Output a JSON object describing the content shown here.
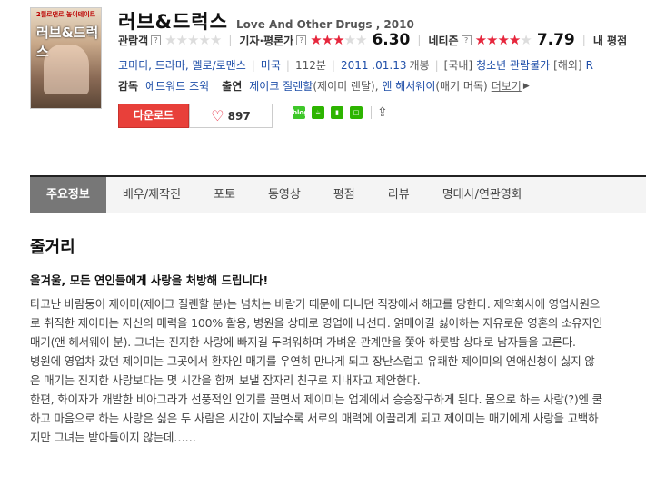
{
  "poster": {
    "top_text": "2월로맨로 놓이테이트",
    "title": "러브&드럭스"
  },
  "movie": {
    "title_ko": "러브&드럭스",
    "title_en": "Love And Other Drugs , 2010"
  },
  "ratings": [
    {
      "label": "관람객",
      "score": "",
      "stars_on": 0
    },
    {
      "label": "기자·평론가",
      "score": "6.30",
      "stars_on": 3
    },
    {
      "label": "네티즌",
      "score": "7.79",
      "stars_on": 4
    },
    {
      "label": "내 평점",
      "score": "",
      "stars_on": 0
    }
  ],
  "info": {
    "genre": "코미디, 드라마, 멜로/로맨스",
    "country": "미국",
    "runtime": "112분",
    "release": "2011 .01.13",
    "release_suffix": "개봉",
    "grade_domestic_label": "[국내]",
    "grade_domestic": "청소년 관람불가",
    "grade_foreign_label": "[해외]",
    "grade_foreign": "R"
  },
  "credits": {
    "director_label": "감독",
    "director": "에드워드 즈윅",
    "cast_label": "출연",
    "cast1": "제이크 질렌할",
    "cast1_role": "(제이미 랜달)",
    "cast2": "앤 해서웨이",
    "cast2_role": "(매기 머독)",
    "more": "더보기"
  },
  "actions": {
    "download": "다운로드",
    "likes": "897"
  },
  "share_icons": [
    {
      "name": "blog-share-icon",
      "text": "blog",
      "color": "#3ec729"
    },
    {
      "name": "cafe-share-icon",
      "text": "☕",
      "color": "#2db400"
    },
    {
      "name": "bookmark-share-icon",
      "text": "▮",
      "color": "#2db400"
    },
    {
      "name": "memo-share-icon",
      "text": "□",
      "color": "#2db400"
    }
  ],
  "tabs": [
    "주요정보",
    "배우/제작진",
    "포토",
    "동영상",
    "평점",
    "리뷰",
    "명대사/연관영화"
  ],
  "synopsis": {
    "heading": "줄거리",
    "tagline": "올겨울, 모든 연인들에게 사랑을 처방해 드립니다!",
    "lines": [
      "타고난 바람둥이 제이미(제이크 질렌할 분)는 넘치는 바람기 때문에 다니던 직장에서 해고를 당한다. 제약회사에 영업사원으",
      "로 취직한 제이미는 자신의 매력을 100% 활용, 병원을 상대로 영업에 나선다. 얽매이길 싫어하는 자유로운 영혼의 소유자인",
      "매기(앤 헤서웨이 분). 그녀는 진지한 사랑에 빠지길 두려워하며 가벼운 관계만을 쫓아 하룻밤 상대로 남자들을 고른다.",
      " 병원에 영업차 갔던 제이미는 그곳에서 환자인 매기를 우연히 만나게 되고 장난스럽고 유쾌한 제이미의 연애신청이 싫지 않",
      "은 매기는 진지한 사랑보다는 몇 시간을 함께 보낼 잠자리 친구로 지내자고 제안한다.",
      " 한편, 화이자가 개발한 비아그라가 선풍적인 인기를 끌면서 제이미는 업계에서 승승장구하게 된다. 몸으로 하는 사랑(?)엔 쿨",
      "하고 마음으로 하는 사랑은 싫은 두 사람은 시간이 지날수록 서로의 매력에 이끌리게 되고 제이미는 매기에게 사랑을 고백하",
      "지만 그녀는 받아들이지 않는데……"
    ]
  }
}
